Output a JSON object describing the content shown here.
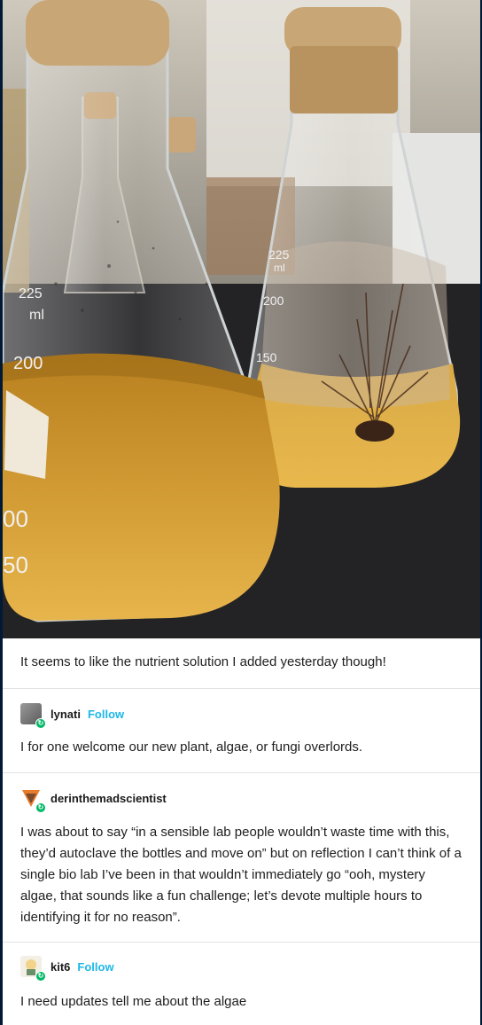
{
  "photo": {
    "left_flask_marks": [
      "225",
      "ml",
      "200",
      "00",
      "50"
    ],
    "right_flask_marks": [
      "225",
      "ml",
      "200",
      "150"
    ]
  },
  "caption": "It seems to like the nutrient solution I added yesterday though!",
  "reblogs": [
    {
      "username": "lynati",
      "follow_label": "Follow",
      "text": "I for one welcome our new plant, algae, or fungi overlords."
    },
    {
      "username": "derinthemadscientist",
      "text": "I was about to say “in a sensible lab people wouldn’t waste time with this, they’d autoclave the bottles and move on” but on reflection I can’t think of a single bio lab I’ve been in that wouldn’t immediately go “ooh, mystery algae, that sounds like a fun challenge; let’s devote multiple hours to identifying it for no reason”."
    },
    {
      "username": "kit6",
      "follow_label": "Follow",
      "text": "I need updates tell me about the algae"
    }
  ],
  "colors": {
    "follow": "#1db7e7",
    "badge": "#00b865",
    "page_bg": "#001935"
  },
  "icons": [
    "reblog-badge-icon"
  ]
}
